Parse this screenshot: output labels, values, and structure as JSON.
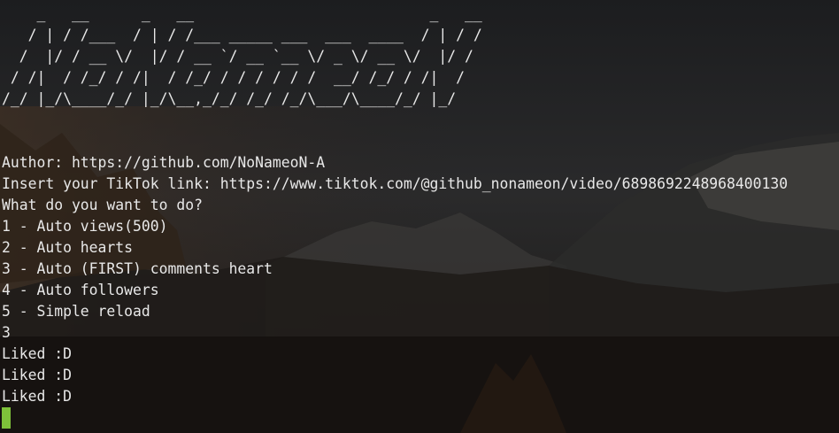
{
  "terminal": {
    "banner": [
      "    _   __      _   __                           _   __",
      "   / | / /___  / | / /___ _____ ___  ___  ____  / | / /",
      "  /  |/ / __ \\/  |/ / __ `/ __ `__ \\/ _ \\/ __ \\/  |/ / ",
      " / /|  / /_/ / /|  / /_/ / / / / / /  __/ /_/ / /|  /  ",
      "/_/ |_/\\____/_/ |_/\\__,_/_/ /_/ /_/\\___/\\____/_/ |_/   "
    ],
    "author_line": "Author: https://github.com/NoNameoN-A",
    "insert_line": "Insert your TikTok link: https://www.tiktok.com/@github_nonameon/video/6898692248968400130",
    "question_line": "What do you want to do?",
    "options": [
      "1 - Auto views(500)",
      "2 - Auto hearts",
      "3 - Auto (FIRST) comments heart",
      "4 - Auto followers",
      "5 - Simple reload"
    ],
    "user_choice": "3",
    "outputs": [
      "Liked :D",
      "Liked :D",
      "Liked :D"
    ],
    "cursor_color": "#7ec13a"
  }
}
